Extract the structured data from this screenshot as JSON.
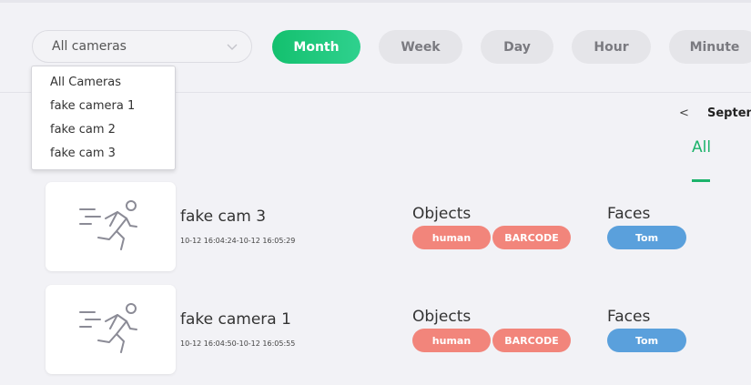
{
  "camera_filter": {
    "selected": "All cameras",
    "options": [
      "All Cameras",
      "fake camera 1",
      "fake cam 2",
      "fake cam 3"
    ]
  },
  "periods": [
    "Month",
    "Week",
    "Day",
    "Hour",
    "Minute"
  ],
  "active_period": "Month",
  "calendar": {
    "prev": "<",
    "month": "Septen"
  },
  "tabs": {
    "all": "All"
  },
  "labels": {
    "objects": "Objects",
    "faces": "Faces"
  },
  "colors": {
    "accent": "#1db36b",
    "object_tag": "#f2857b",
    "face_tag": "#5aa0dc"
  },
  "events": [
    {
      "camera": "fake cam 3",
      "time": "10-12 16:04:24-10-12 16:05:29",
      "objects": [
        "human",
        "BARCODE"
      ],
      "faces": [
        "Tom"
      ]
    },
    {
      "camera": "fake camera 1",
      "time": "10-12 16:04:50-10-12 16:05:55",
      "objects": [
        "human",
        "BARCODE"
      ],
      "faces": [
        "Tom"
      ]
    }
  ]
}
